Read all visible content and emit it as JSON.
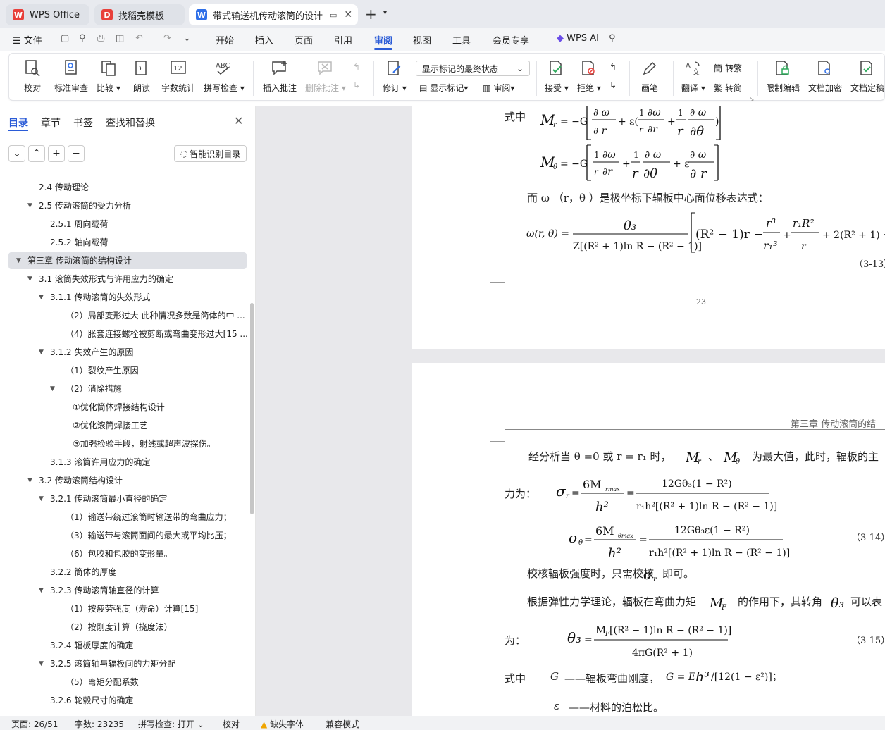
{
  "tabs": [
    {
      "label": "WPS Office"
    },
    {
      "label": "找稻壳模板"
    },
    {
      "label": "带式输送机传动滚筒的设计 说"
    }
  ],
  "menu": {
    "file": "文件",
    "items": [
      "开始",
      "插入",
      "页面",
      "引用",
      "审阅",
      "视图",
      "工具",
      "会员专享"
    ],
    "ai": "WPS AI"
  },
  "ribbon": {
    "proofread": "校对",
    "std_review": "标准审查",
    "compare": "比较",
    "read_aloud": "朗读",
    "word_count": "字数统计",
    "spell_check": "拼写检查",
    "insert_comment": "插入批注",
    "delete_comment": "删除批注",
    "revise": "修订",
    "markup_mode": "显示标记的最终状态",
    "show_markup": "显示标记",
    "review": "审阅",
    "accept": "接受",
    "reject": "拒绝",
    "pen": "画笔",
    "translate": "翻译",
    "to_traditional": "转繁",
    "to_simplified": "转简",
    "restrict_edit": "限制编辑",
    "encrypt_doc": "文档加密",
    "finalize_doc": "文档定稿",
    "word_count_icon": "12"
  },
  "sidebar": {
    "tabs": [
      "目录",
      "章节",
      "书签",
      "查找和替换"
    ],
    "smart_toc": "智能识别目录",
    "items": [
      {
        "text": "2.4  传动理论"
      },
      {
        "text": "2.5  传动滚筒的受力分析"
      },
      {
        "text": "2.5.1  周向载荷"
      },
      {
        "text": "2.5.2  轴向载荷"
      },
      {
        "text": "第三章  传动滚筒的结构设计"
      },
      {
        "text": "3.1  滚筒失效形式与许用应力的确定"
      },
      {
        "text": "3.1.1  传动滚筒的失效形式"
      },
      {
        "text": "（2）局部变形过大  此种情况多数是简体的中 ..."
      },
      {
        "text": "（4）胀套连接螺栓被剪断或弯曲变形过大[15 ..."
      },
      {
        "text": "3.1.2  失效产生的原因"
      },
      {
        "text": "（1）裂纹产生原因"
      },
      {
        "text": "（2）消除措施"
      },
      {
        "text": "①优化筒体焊接结构设计"
      },
      {
        "text": "②优化滚筒焊接工艺"
      },
      {
        "text": "③加强检验手段，射线或超声波探伤。"
      },
      {
        "text": "3.1.3  滚筒许用应力的确定"
      },
      {
        "text": "3.2  传动滚筒结构设计"
      },
      {
        "text": "3.2.1  传动滚筒最小直径的确定"
      },
      {
        "text": "（1）输送带绕过滚筒时输送带的弯曲应力；"
      },
      {
        "text": "（3）输送带与滚筒面间的最大或平均比压；"
      },
      {
        "text": "（6）包胶和包胶的变形量。"
      },
      {
        "text": "3.2.2  筒体的厚度"
      },
      {
        "text": "3.2.3  传动滚筒轴直径的计算"
      },
      {
        "text": "（1）按疲劳强度（寿命）计算[15]"
      },
      {
        "text": "（2）按刚度计算（挠度法）"
      },
      {
        "text": "3.2.4  辐板厚度的确定"
      },
      {
        "text": "3.2.5  滚筒轴与辐板间的力矩分配"
      },
      {
        "text": "（5）弯矩分配系数"
      },
      {
        "text": "3.2.6  轮毂尺寸的确定"
      }
    ]
  },
  "doc": {
    "p1": {
      "shizhong": "式中",
      "omega_expr": "而 ω （r，θ  ）是极坐标下辐板中心面位移表达式：",
      "eq13": "（3-13）",
      "page_num": "23"
    },
    "p2": {
      "header": "第三章  传动滚筒的结",
      "line1": "经分析当 θ  =0  或 r = r₁ 时，",
      "line1b": "为最大值，此时，辐板的主",
      "force": "力为：",
      "eq14": "（3-14）",
      "check": "校核辐板强度时，只需校核",
      "check_b": "即可。",
      "theory": "根据弹性力学理论，辐板在弯曲力矩",
      "theory_b": "的作用下，其转角",
      "theory_c": "可以表",
      "wei": "为：",
      "eq15": "（3-15）",
      "shizhong2": "式中",
      "g_desc": "——辐板弯曲刚度，",
      "eps_desc": "——材料的泊松比。"
    }
  },
  "status": {
    "page": "页面: 26/51",
    "words": "字数: 23235",
    "spell": "拼写检查: 打开",
    "proof": "校对",
    "missing_font": "缺失字体",
    "compat": "兼容模式"
  },
  "colors": {
    "accent": "#3b6ee8",
    "wps_red": "#e8403b",
    "warning": "#f0a500"
  }
}
